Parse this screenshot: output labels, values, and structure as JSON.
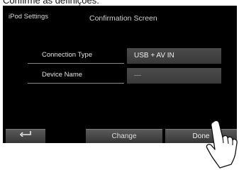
{
  "caption": "Confirme as definições.",
  "header": {
    "title": "iPod Settings",
    "subtitle": "Confirmation Screen"
  },
  "rows": [
    {
      "label": "Connection Type",
      "value": "USB + AV IN"
    },
    {
      "label": "Device Name",
      "value": "—"
    }
  ],
  "buttons": {
    "back_icon": "back-arrow-icon",
    "change_label": "Change",
    "done_label": "Done"
  },
  "colors": {
    "screen_bg": "#000000",
    "value_bg": "#444444",
    "button_bg": "#4a4a4a",
    "text": "#e0e0e0"
  }
}
